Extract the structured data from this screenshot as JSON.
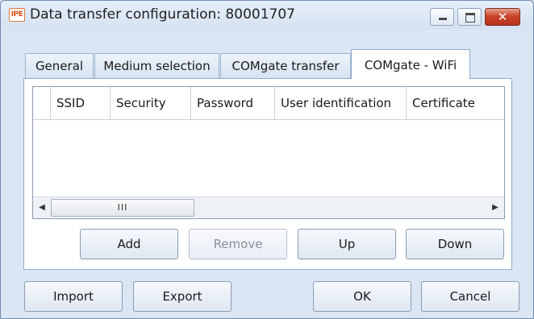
{
  "window": {
    "title": "Data transfer configuration: 80001707",
    "app_icon_text": "IPE",
    "close_glyph": "✕"
  },
  "tabs": [
    {
      "label": "General",
      "active": false
    },
    {
      "label": "Medium selection",
      "active": false
    },
    {
      "label": "COMgate transfer",
      "active": false
    },
    {
      "label": "COMgate - WiFi",
      "active": true
    }
  ],
  "grid": {
    "columns": [
      "SSID",
      "Security",
      "Password",
      "User identification",
      "Certificate"
    ],
    "rows": [],
    "scroll_thumb_grip": "III",
    "scroll_left_arrow": "◀",
    "scroll_right_arrow": "▶"
  },
  "panel_buttons": {
    "add": "Add",
    "remove": "Remove",
    "up": "Up",
    "down": "Down"
  },
  "footer_buttons": {
    "import": "Import",
    "export": "Export",
    "ok": "OK",
    "cancel": "Cancel"
  },
  "colors": {
    "accent": "#cfdcec",
    "close_button": "#c9452a",
    "app_icon": "#d9531e"
  }
}
